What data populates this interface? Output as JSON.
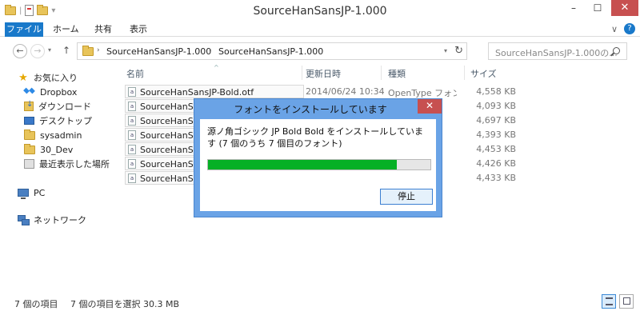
{
  "window": {
    "title": "SourceHanSansJP-1.000",
    "minimize": "–",
    "maximize": "☐",
    "close": "✕"
  },
  "ribbon": {
    "tabs": [
      "ファイル",
      "ホーム",
      "共有",
      "表示"
    ],
    "expand": "∨",
    "help": "?"
  },
  "address": {
    "crumbs": [
      "SourceHanSansJP-1.000",
      "SourceHanSansJP-1.000"
    ],
    "separator": "›",
    "search_placeholder": "SourceHanSansJP-1.000の..."
  },
  "nav": {
    "favorites": "お気に入り",
    "items": [
      "Dropbox",
      "ダウンロード",
      "デスクトップ",
      "sysadmin",
      "30_Dev",
      "最近表示した場所"
    ],
    "pc": "PC",
    "network": "ネットワーク"
  },
  "columns": {
    "name": "名前",
    "date": "更新日時",
    "type": "種類",
    "size": "サイズ"
  },
  "files": [
    {
      "name": "SourceHanSansJP-Bold.otf",
      "date": "2014/06/24 10:34",
      "type": "OpenType フォン...",
      "size": "4,558 KB"
    },
    {
      "name": "SourceHanSansJP-ExtraLight.otf",
      "date": "",
      "type": "",
      "size": "4,093 KB"
    },
    {
      "name": "SourceHanSansJP-Heavy.otf",
      "date": "",
      "type": "",
      "size": "4,697 KB"
    },
    {
      "name": "SourceHanSansJP-Light.otf",
      "date": "",
      "type": "",
      "size": "4,393 KB"
    },
    {
      "name": "SourceHanSansJP-Medium.otf",
      "date": "",
      "type": "",
      "size": "4,453 KB"
    },
    {
      "name": "SourceHanSansJP-Normal.otf",
      "date": "",
      "type": "",
      "size": "4,426 KB"
    },
    {
      "name": "SourceHanSansJP-Regular.otf",
      "date": "",
      "type": "",
      "size": "4,433 KB"
    }
  ],
  "status": {
    "count": "7 個の項目",
    "selected": "7 個の項目を選択  30.3 MB"
  },
  "dialog": {
    "title": "フォントをインストールしています",
    "message": "源ノ角ゴシック JP Bold Bold をインストールしています (7 個のうち 7 個目のフォント)",
    "progress": 0.85,
    "stop_label": "停止",
    "close": "✕"
  },
  "colors": {
    "accent": "#1979ca",
    "progress": "#06b025",
    "close": "#c75050",
    "dialog_frame": "#6aa3e6"
  }
}
